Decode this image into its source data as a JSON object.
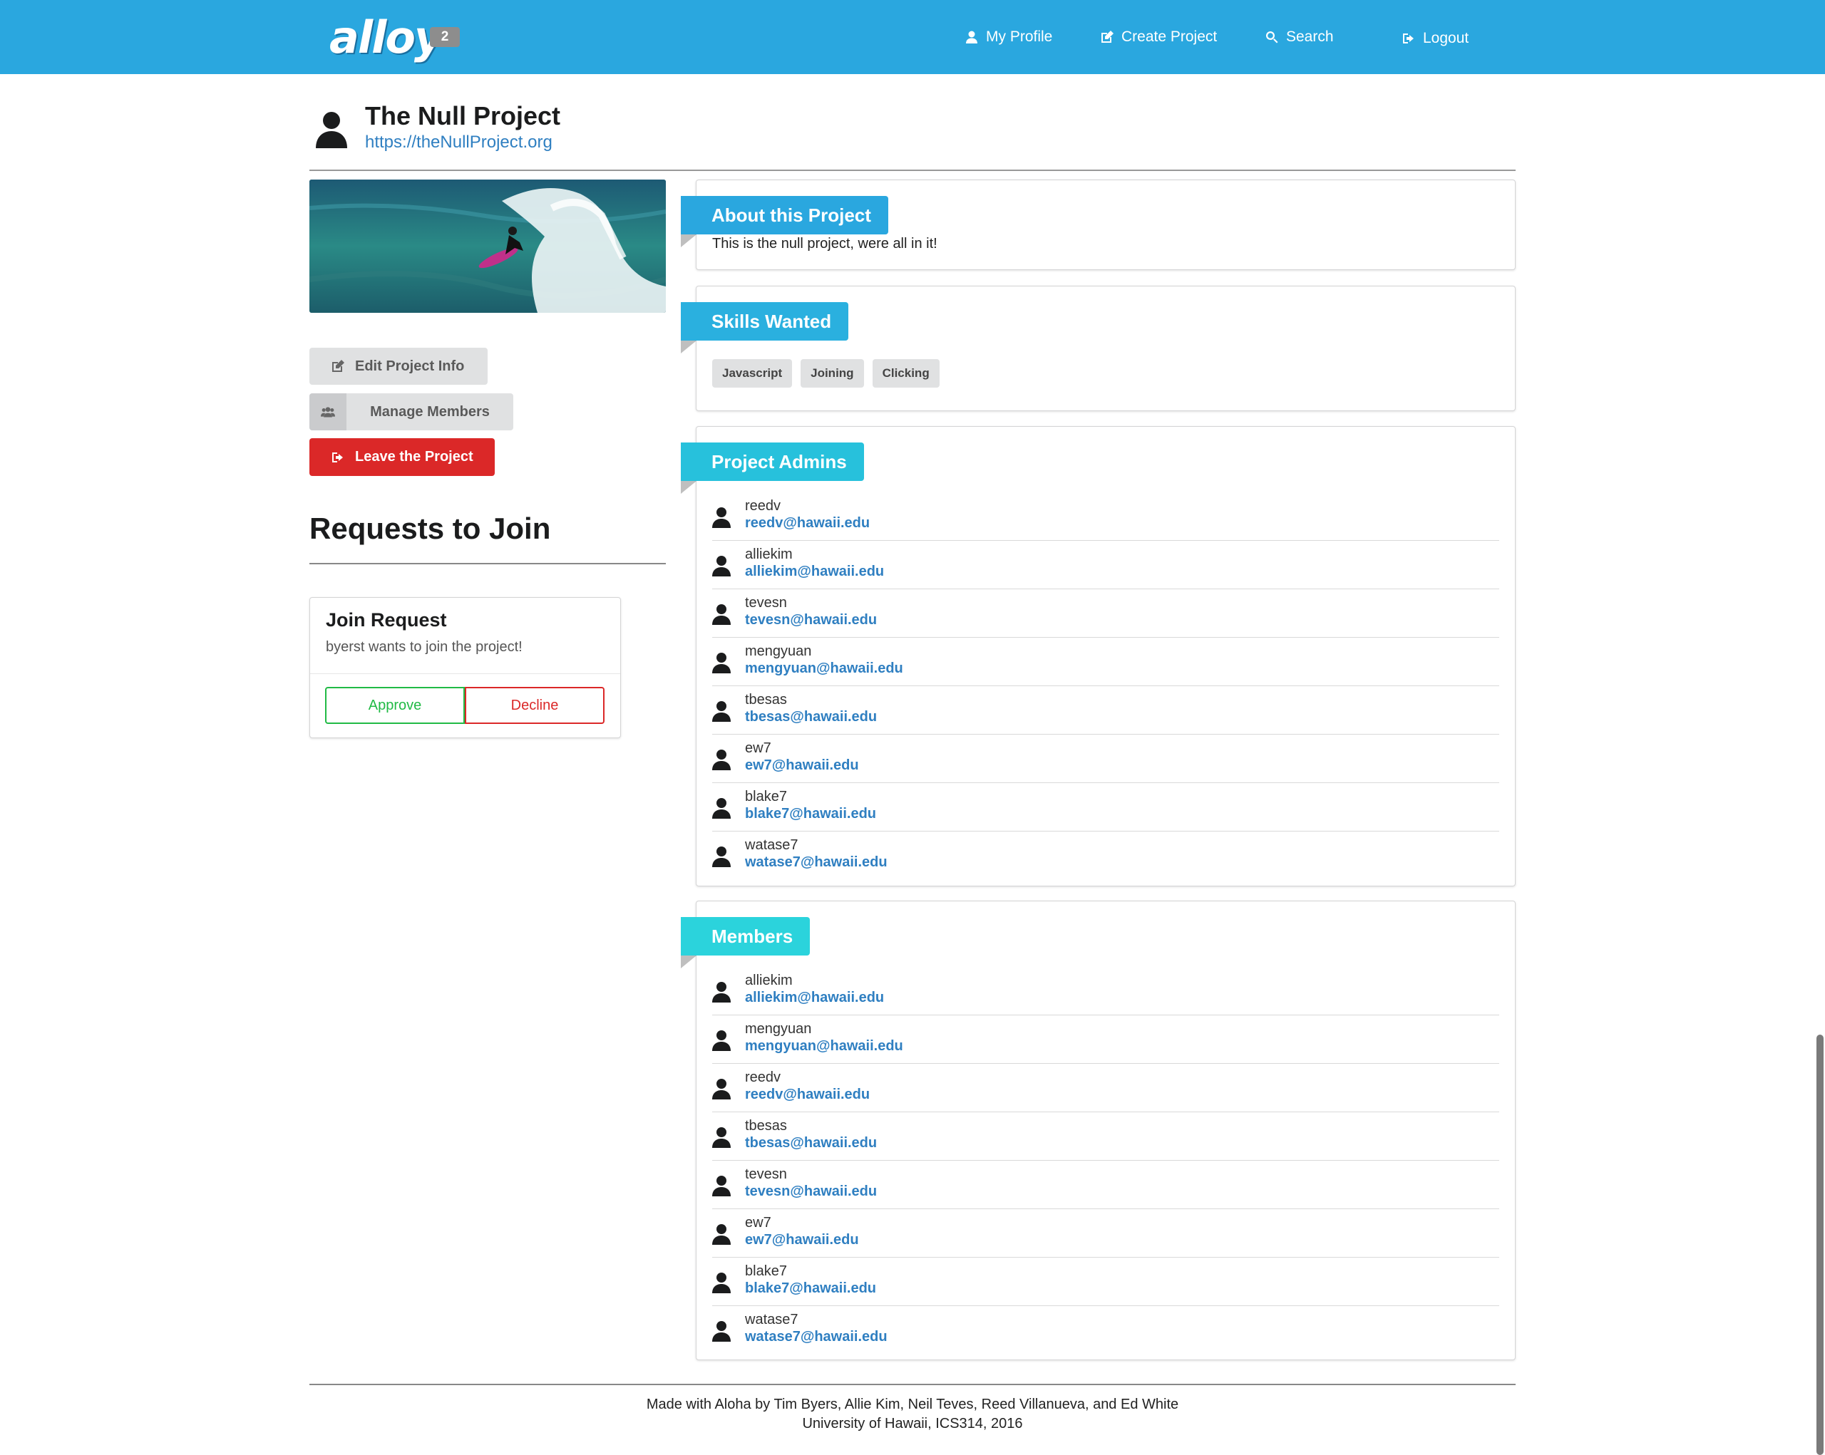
{
  "navbar": {
    "logo": "alloy",
    "badge": "2",
    "items": [
      {
        "label": "My Profile",
        "icon": "user-icon"
      },
      {
        "label": "Create Project",
        "icon": "edit-icon"
      },
      {
        "label": "Search",
        "icon": "search-icon"
      },
      {
        "label": "Logout",
        "icon": "sign-out-icon"
      }
    ],
    "color": "#2aa7df"
  },
  "project": {
    "title": "The Null Project",
    "url": "https://theNullProject.org"
  },
  "actions": {
    "edit": "Edit Project Info",
    "manage": "Manage Members",
    "leave": "Leave the Project"
  },
  "requests": {
    "title": "Requests to Join",
    "card": {
      "header": "Join Request",
      "description": "byerst wants to join the project!",
      "approve": "Approve",
      "decline": "Decline"
    }
  },
  "about": {
    "title": "About this Project",
    "text": "This is the null project, were all in it!",
    "color": "#2aa7df"
  },
  "skills": {
    "title": "Skills Wanted",
    "items": [
      "Javascript",
      "Joining",
      "Clicking"
    ],
    "color": "#2ab0df"
  },
  "admins": {
    "title": "Project Admins",
    "color": "#27c1dc",
    "people": [
      {
        "name": "reedv",
        "email": "reedv@hawaii.edu"
      },
      {
        "name": "alliekim",
        "email": "alliekim@hawaii.edu"
      },
      {
        "name": "tevesn",
        "email": "tevesn@hawaii.edu"
      },
      {
        "name": "mengyuan",
        "email": "mengyuan@hawaii.edu"
      },
      {
        "name": "tbesas",
        "email": "tbesas@hawaii.edu"
      },
      {
        "name": "ew7",
        "email": "ew7@hawaii.edu"
      },
      {
        "name": "blake7",
        "email": "blake7@hawaii.edu"
      },
      {
        "name": "watase7",
        "email": "watase7@hawaii.edu"
      }
    ]
  },
  "members": {
    "title": "Members",
    "color": "#2bd3dc",
    "people": [
      {
        "name": "alliekim",
        "email": "alliekim@hawaii.edu"
      },
      {
        "name": "mengyuan",
        "email": "mengyuan@hawaii.edu"
      },
      {
        "name": "reedv",
        "email": "reedv@hawaii.edu"
      },
      {
        "name": "tbesas",
        "email": "tbesas@hawaii.edu"
      },
      {
        "name": "tevesn",
        "email": "tevesn@hawaii.edu"
      },
      {
        "name": "ew7",
        "email": "ew7@hawaii.edu"
      },
      {
        "name": "blake7",
        "email": "blake7@hawaii.edu"
      },
      {
        "name": "watase7",
        "email": "watase7@hawaii.edu"
      }
    ]
  },
  "footer": {
    "line1": "Made with Aloha by Tim Byers, Allie Kim, Neil Teves, Reed Villanueva, and Ed White",
    "line2": "University of Hawaii, ICS314, 2016"
  }
}
